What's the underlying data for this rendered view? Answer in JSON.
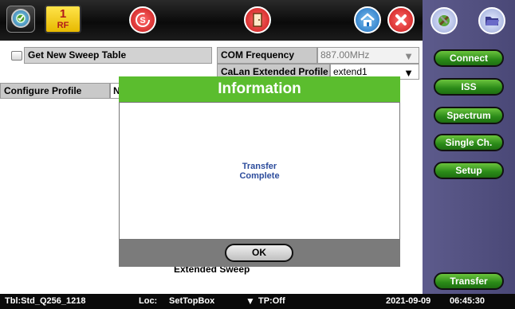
{
  "top": {
    "rf_number": "1",
    "rf_label": "RF"
  },
  "form": {
    "get_new_sweep_table": "Get New Sweep Table",
    "com_frequency_label": "COM Frequency",
    "com_frequency_value": "887.00MHz",
    "calan_extended_profile_label": "CaLan Extended Profile",
    "calan_extended_profile_value": "extend1",
    "configure_profile_label": "Configure Profile",
    "configure_profile_value": "N",
    "extended_sweep_label": "Extended Sweep"
  },
  "dialog": {
    "title": "Information",
    "message_line1": "Transfer",
    "message_line2": "Complete",
    "ok_label": "OK"
  },
  "side_menu": {
    "connect": "Connect",
    "iss": "ISS",
    "spectrum": "Spectrum",
    "single_ch": "Single Ch.",
    "setup": "Setup",
    "transfer": "Transfer"
  },
  "status": {
    "table": "Tbl:Std_Q256_1218",
    "loc_label": "Loc:",
    "loc_value": "SetTopBox",
    "tp": "TP:Off",
    "date": "2021-09-09",
    "time": "06:45:30"
  },
  "colors": {
    "accent_green": "#5bbd2e",
    "side_panel": "#4f4d80",
    "stop_red": "#e02020"
  },
  "icons": [
    "gauge-icon",
    "stop-s-icon",
    "exit-door-icon",
    "home-icon",
    "close-icon",
    "tools-icon",
    "folder-icon"
  ]
}
